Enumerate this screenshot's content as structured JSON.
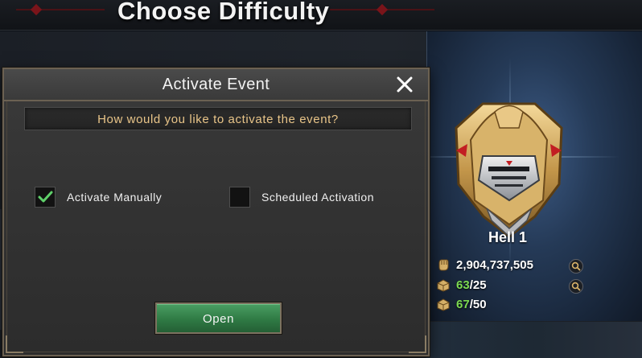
{
  "page": {
    "title": "Choose Difficulty"
  },
  "difficulty_card": {
    "name": "Hell 1",
    "power": "2,904,737,505",
    "stat_2_current": "63",
    "stat_2_total": "/25",
    "stat_3_current": "67",
    "stat_3_total": "/50",
    "icons": [
      "fist-icon",
      "supply-box-icon",
      "supply-box-icon",
      "magnifier-icon"
    ]
  },
  "modal": {
    "title": "Activate Event",
    "prompt": "How would you like to activate the event?",
    "options": [
      {
        "label": "Activate Manually",
        "checked": true
      },
      {
        "label": "Scheduled Activation",
        "checked": false
      }
    ],
    "open_label": "Open",
    "close_icon": "close-icon"
  },
  "colors": {
    "prompt_text": "#e8c488",
    "button_green": "#2f7a44",
    "check_green": "#5fd06a",
    "stat_green": "#7ddb52",
    "frame_gold": "#6b6152"
  }
}
